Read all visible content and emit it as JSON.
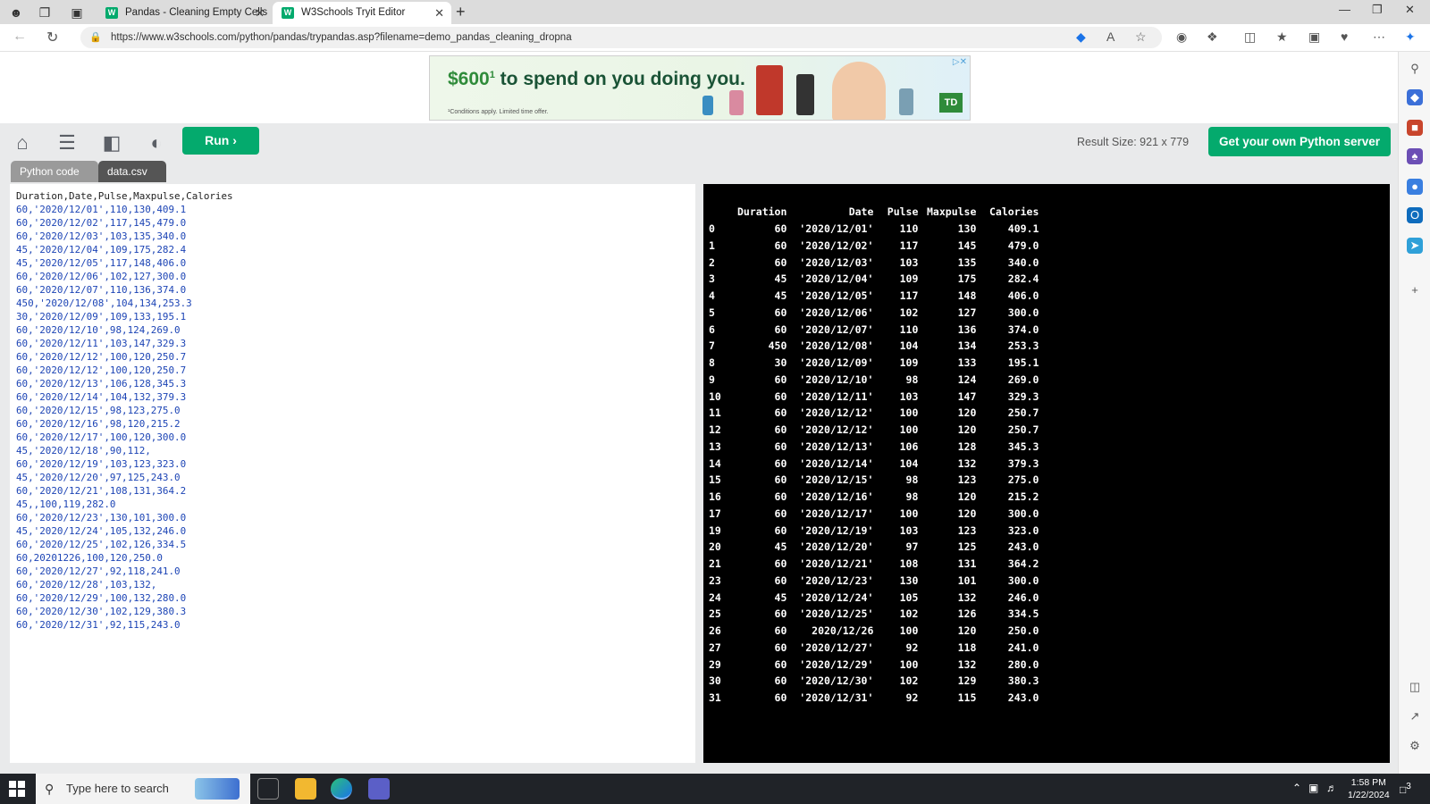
{
  "browser": {
    "tabs": [
      {
        "title": "Pandas - Cleaning Empty Cells",
        "favicon": "W"
      },
      {
        "title": "W3Schools Tryit Editor",
        "favicon": "W"
      }
    ],
    "url": "https://www.w3schools.com/python/pandas/trypandas.asp?filename=demo_pandas_cleaning_dropna"
  },
  "ad": {
    "amount": "$600",
    "superscript": "1",
    "headline": " to spend on you doing you.",
    "fine_print": "¹Conditions apply. Limited time offer.",
    "brand": "TD"
  },
  "toolbar": {
    "run_label": "Run",
    "result_size": "Result Size: 921 x 779",
    "server_label": "Get your own Python server"
  },
  "file_tabs": [
    "Python code",
    "data.csv"
  ],
  "csv": {
    "header": "Duration,Date,Pulse,Maxpulse,Calories",
    "lines": [
      "60,'2020/12/01',110,130,409.1",
      "60,'2020/12/02',117,145,479.0",
      "60,'2020/12/03',103,135,340.0",
      "45,'2020/12/04',109,175,282.4",
      "45,'2020/12/05',117,148,406.0",
      "60,'2020/12/06',102,127,300.0",
      "60,'2020/12/07',110,136,374.0",
      "450,'2020/12/08',104,134,253.3",
      "30,'2020/12/09',109,133,195.1",
      "60,'2020/12/10',98,124,269.0",
      "60,'2020/12/11',103,147,329.3",
      "60,'2020/12/12',100,120,250.7",
      "60,'2020/12/12',100,120,250.7",
      "60,'2020/12/13',106,128,345.3",
      "60,'2020/12/14',104,132,379.3",
      "60,'2020/12/15',98,123,275.0",
      "60,'2020/12/16',98,120,215.2",
      "60,'2020/12/17',100,120,300.0",
      "45,'2020/12/18',90,112,",
      "60,'2020/12/19',103,123,323.0",
      "45,'2020/12/20',97,125,243.0",
      "60,'2020/12/21',108,131,364.2",
      "45,,100,119,282.0",
      "60,'2020/12/23',130,101,300.0",
      "45,'2020/12/24',105,132,246.0",
      "60,'2020/12/25',102,126,334.5",
      "60,20201226,100,120,250.0",
      "60,'2020/12/27',92,118,241.0",
      "60,'2020/12/28',103,132,",
      "60,'2020/12/29',100,132,280.0",
      "60,'2020/12/30',102,129,380.3",
      "60,'2020/12/31',92,115,243.0"
    ]
  },
  "result": {
    "columns": [
      "Duration",
      "Date",
      "Pulse",
      "Maxpulse",
      "Calories"
    ],
    "rows": [
      [
        "0",
        "60",
        "'2020/12/01'",
        "110",
        "130",
        "409.1"
      ],
      [
        "1",
        "60",
        "'2020/12/02'",
        "117",
        "145",
        "479.0"
      ],
      [
        "2",
        "60",
        "'2020/12/03'",
        "103",
        "135",
        "340.0"
      ],
      [
        "3",
        "45",
        "'2020/12/04'",
        "109",
        "175",
        "282.4"
      ],
      [
        "4",
        "45",
        "'2020/12/05'",
        "117",
        "148",
        "406.0"
      ],
      [
        "5",
        "60",
        "'2020/12/06'",
        "102",
        "127",
        "300.0"
      ],
      [
        "6",
        "60",
        "'2020/12/07'",
        "110",
        "136",
        "374.0"
      ],
      [
        "7",
        "450",
        "'2020/12/08'",
        "104",
        "134",
        "253.3"
      ],
      [
        "8",
        "30",
        "'2020/12/09'",
        "109",
        "133",
        "195.1"
      ],
      [
        "9",
        "60",
        "'2020/12/10'",
        "98",
        "124",
        "269.0"
      ],
      [
        "10",
        "60",
        "'2020/12/11'",
        "103",
        "147",
        "329.3"
      ],
      [
        "11",
        "60",
        "'2020/12/12'",
        "100",
        "120",
        "250.7"
      ],
      [
        "12",
        "60",
        "'2020/12/12'",
        "100",
        "120",
        "250.7"
      ],
      [
        "13",
        "60",
        "'2020/12/13'",
        "106",
        "128",
        "345.3"
      ],
      [
        "14",
        "60",
        "'2020/12/14'",
        "104",
        "132",
        "379.3"
      ],
      [
        "15",
        "60",
        "'2020/12/15'",
        "98",
        "123",
        "275.0"
      ],
      [
        "16",
        "60",
        "'2020/12/16'",
        "98",
        "120",
        "215.2"
      ],
      [
        "17",
        "60",
        "'2020/12/17'",
        "100",
        "120",
        "300.0"
      ],
      [
        "19",
        "60",
        "'2020/12/19'",
        "103",
        "123",
        "323.0"
      ],
      [
        "20",
        "45",
        "'2020/12/20'",
        "97",
        "125",
        "243.0"
      ],
      [
        "21",
        "60",
        "'2020/12/21'",
        "108",
        "131",
        "364.2"
      ],
      [
        "23",
        "60",
        "'2020/12/23'",
        "130",
        "101",
        "300.0"
      ],
      [
        "24",
        "45",
        "'2020/12/24'",
        "105",
        "132",
        "246.0"
      ],
      [
        "25",
        "60",
        "'2020/12/25'",
        "102",
        "126",
        "334.5"
      ],
      [
        "26",
        "60",
        "2020/12/26",
        "100",
        "120",
        "250.0"
      ],
      [
        "27",
        "60",
        "'2020/12/27'",
        "92",
        "118",
        "241.0"
      ],
      [
        "29",
        "60",
        "'2020/12/29'",
        "100",
        "132",
        "280.0"
      ],
      [
        "30",
        "60",
        "'2020/12/30'",
        "102",
        "129",
        "380.3"
      ],
      [
        "31",
        "60",
        "'2020/12/31'",
        "92",
        "115",
        "243.0"
      ]
    ]
  },
  "taskbar": {
    "search_placeholder": "Type here to search",
    "time": "1:58 PM",
    "date": "1/22/2024",
    "notification_count": "3"
  },
  "colors": {
    "accent": "#04aa6d"
  }
}
